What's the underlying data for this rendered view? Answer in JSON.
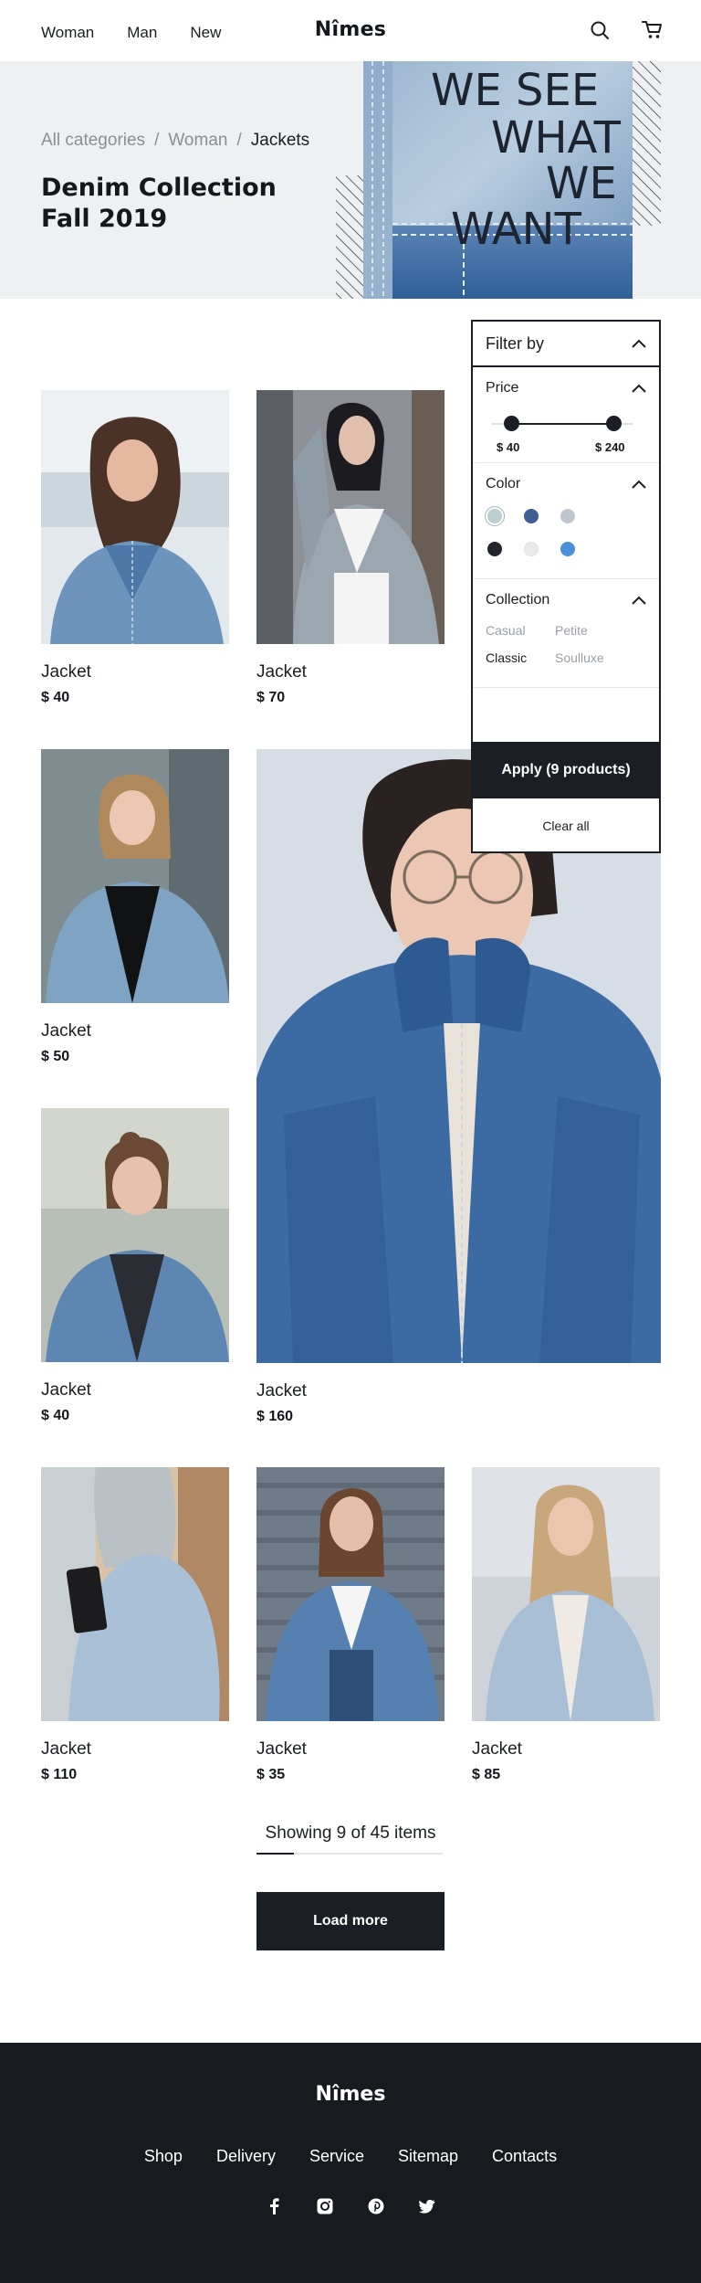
{
  "header": {
    "nav": [
      "Woman",
      "Man",
      "New"
    ],
    "logo": "Nîmes",
    "icons": [
      "search-icon",
      "cart-icon"
    ]
  },
  "hero": {
    "breadcrumb": [
      "All categories",
      "Woman",
      "Jackets"
    ],
    "separator": "/",
    "title": "Denim Collection Fall 2019",
    "jacket_text": [
      "WE SEE",
      "WHAT",
      "WE",
      "WANT"
    ]
  },
  "products": [
    {
      "name": "Jacket",
      "price": "$ 40"
    },
    {
      "name": "Jacket",
      "price": "$ 70"
    },
    {
      "name": "Jacket",
      "price": "$ 50"
    },
    {
      "name": "Jacket",
      "price": "$ 160"
    },
    {
      "name": "Jacket",
      "price": "$ 40"
    },
    {
      "name": "Jacket",
      "price": "$ 110"
    },
    {
      "name": "Jacket",
      "price": "$ 35"
    },
    {
      "name": "Jacket",
      "price": "$ 85"
    }
  ],
  "filter": {
    "title": "Filter by",
    "price": {
      "label": "Price",
      "min": "$ 40",
      "max": "$ 240"
    },
    "color": {
      "label": "Color",
      "swatches": [
        "#b9cfd0",
        "#3e5f95",
        "#c0c6cf",
        "#22252a",
        "#e9eaec",
        "#4a8fd9"
      ],
      "selected": "#b9cfd0"
    },
    "collection": {
      "label": "Collection",
      "options": [
        "Casual",
        "Petite",
        "Classic",
        "Soulluxe"
      ],
      "selected": "Classic"
    },
    "apply": "Apply (9 products)",
    "clear": "Clear all"
  },
  "pagination": {
    "showing": "Showing 9 of 45 items",
    "shown": 9,
    "total": 45,
    "load_more": "Load more"
  },
  "footer": {
    "logo": "Nîmes",
    "links": [
      "Shop",
      "Delivery",
      "Service",
      "Sitemap",
      "Contacts"
    ],
    "social": [
      "facebook-icon",
      "instagram-icon",
      "pinterest-icon",
      "twitter-icon"
    ]
  },
  "colors": {
    "primary_dark": "#171a1f",
    "muted_text": "#8a8e95",
    "hero_bg": "#eff0f2"
  }
}
